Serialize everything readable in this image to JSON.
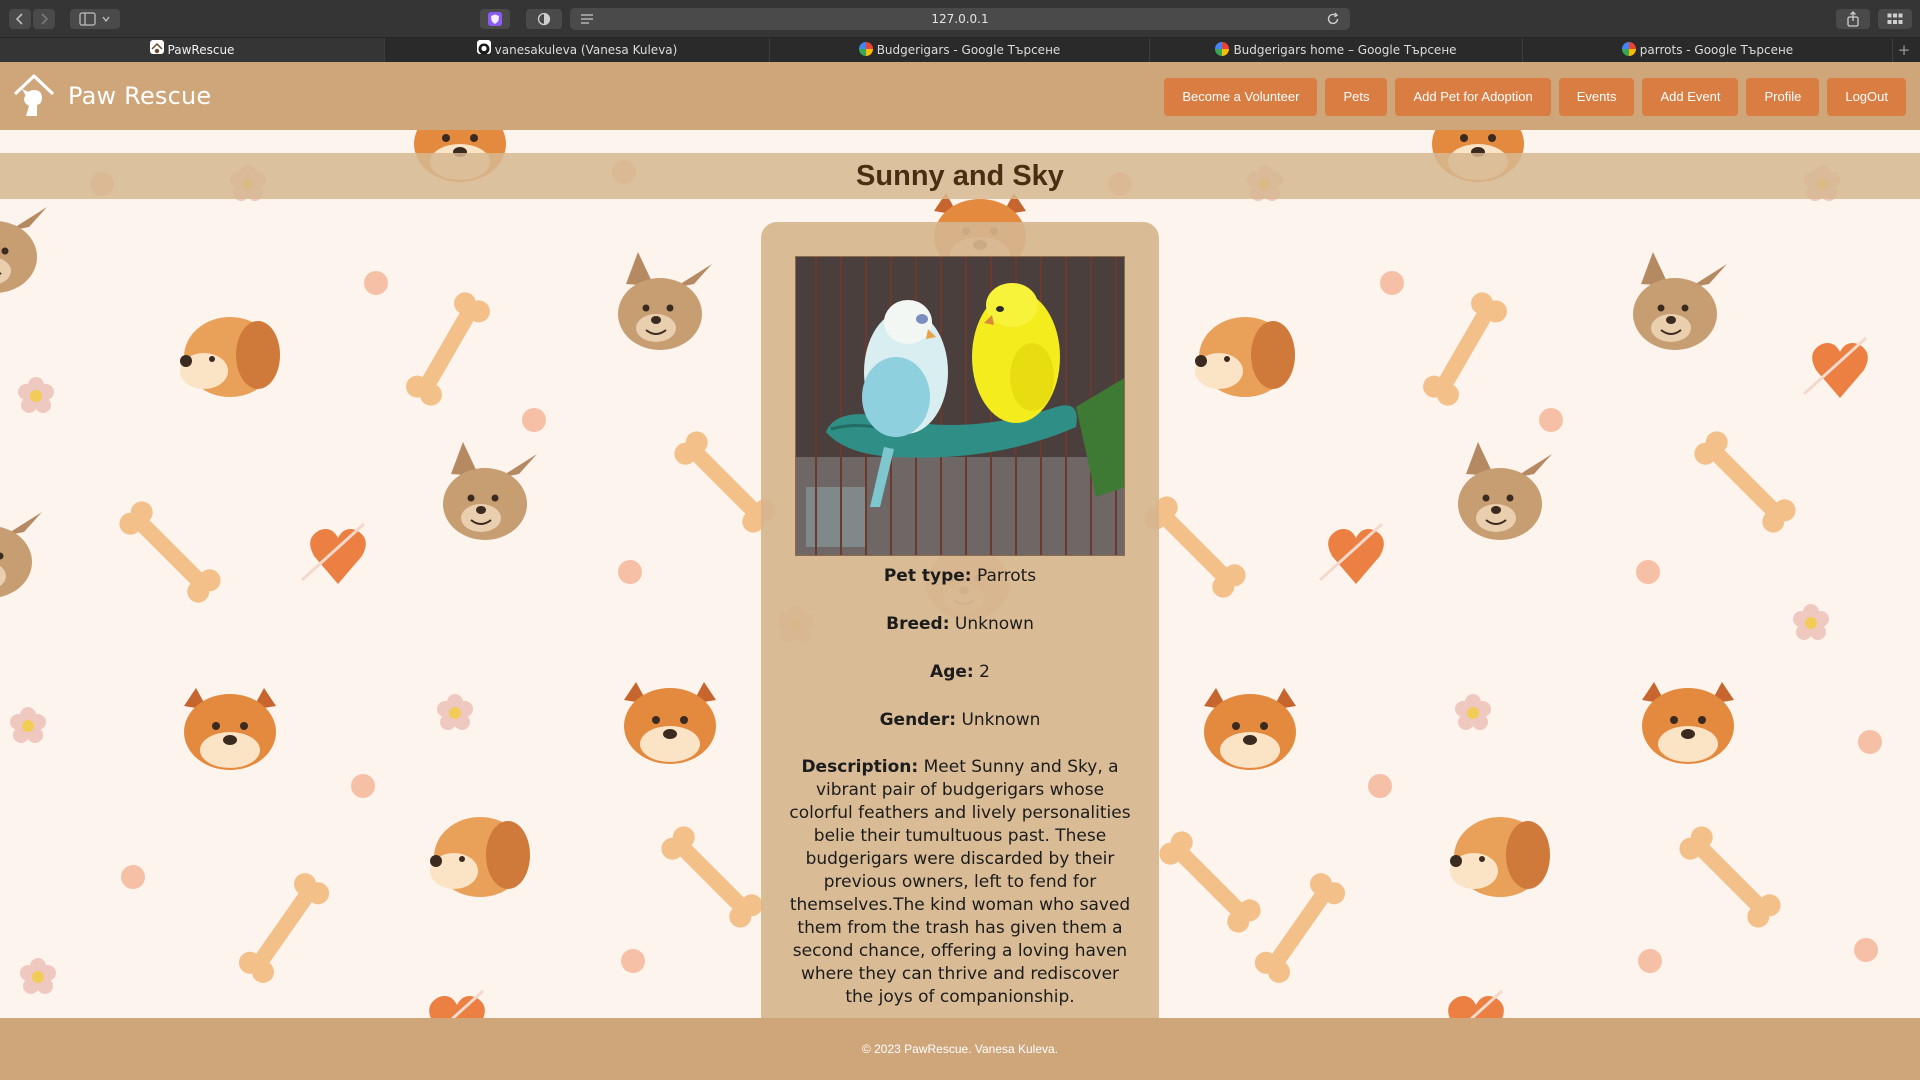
{
  "browser": {
    "url": "127.0.0.1",
    "tabs": [
      {
        "label": "PawRescue",
        "active": true
      },
      {
        "label": "vanesakuleva (Vanesa Kuleva)",
        "active": false
      },
      {
        "label": "Budgerigars - Google Търсене",
        "active": false
      },
      {
        "label": "Budgerigars home – Google Търсене",
        "active": false
      },
      {
        "label": "parrots - Google Търсене",
        "active": false
      }
    ],
    "new_tab_glyph": "+"
  },
  "site": {
    "brand": "Paw Rescue",
    "nav": [
      "Become a Volunteer",
      "Pets",
      "Add Pet for Adoption",
      "Events",
      "Add Event",
      "Profile",
      "LogOut"
    ]
  },
  "pet": {
    "name": "Sunny and Sky",
    "photo_alt_icon": "budgerigars-photo",
    "type_label": "Pet type:",
    "type": "Parrots",
    "breed_label": "Breed:",
    "breed": "Unknown",
    "age_label": "Age:",
    "age": "2",
    "gender_label": "Gender:",
    "gender": "Unknown",
    "description_label": "Description:",
    "description": "Meet Sunny and Sky, a vibrant pair of budgerigars whose colorful feathers and lively personalities belie their tumultuous past. These budgerigars were discarded by their previous owners, left to fend for themselves.The kind woman who saved them from the trash has given them a second chance, offering a loving haven where they can thrive and rediscover the joys of companionship."
  },
  "footer": {
    "text": "© 2023 PawRescue. Vanesa Kuleva."
  },
  "colors": {
    "navbar": "#cfa57a",
    "nav_button": "#d97d43",
    "page_bg": "#fdf4ee",
    "title_text": "#4a2e12",
    "card": "#d6b58e"
  }
}
